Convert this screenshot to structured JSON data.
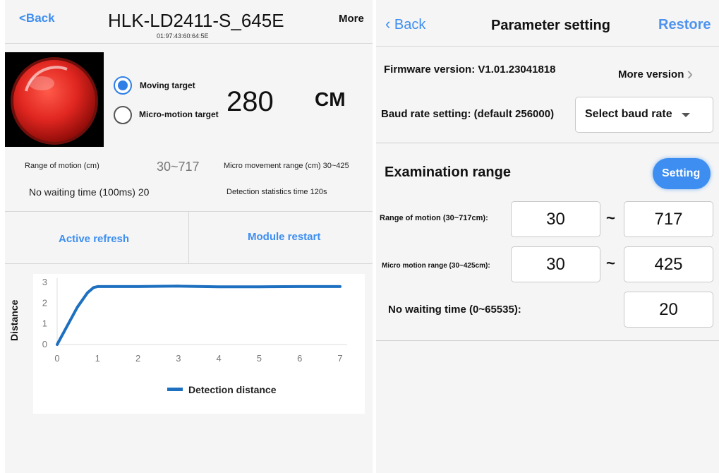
{
  "left": {
    "header": {
      "back_label": "<Back",
      "title": "HLK-LD2411-S_645E",
      "mac": "01:97:43:60:64:5E",
      "more_label": "More"
    },
    "status": {
      "moving_label": "Moving target",
      "micro_label": "Micro-motion target",
      "selected": "moving",
      "distance_value": "280",
      "distance_unit": "CM"
    },
    "info": {
      "range_motion_label": "Range of motion (cm)",
      "range_motion_value": "30~717",
      "micro_range_text": "Micro movement range (cm) 30~425",
      "no_wait_text": "No waiting time (100ms) 20",
      "detection_stats_text": "Detection statistics time 120s"
    },
    "actions": {
      "active_refresh": "Active refresh",
      "module_restart": "Module restart"
    },
    "accent_color": "#3d8ef0",
    "indicator_color": "#e02620"
  },
  "chart_data": {
    "type": "line",
    "ylabel": "Distance",
    "xlabel": "",
    "x_ticks": [
      "0",
      "1",
      "2",
      "3",
      "4",
      "5",
      "6",
      "7"
    ],
    "y_ticks": [
      "0",
      "1",
      "2",
      "3"
    ],
    "xlim": [
      0,
      7
    ],
    "ylim": [
      0,
      3
    ],
    "legend_position": "bottom",
    "series": [
      {
        "name": "Detection distance",
        "color": "#1d6fbf",
        "x": [
          0,
          0.25,
          0.5,
          0.75,
          0.9,
          1,
          2,
          3,
          4,
          5,
          6,
          7
        ],
        "values": [
          0,
          0.9,
          1.8,
          2.5,
          2.75,
          2.8,
          2.8,
          2.82,
          2.79,
          2.79,
          2.8,
          2.8
        ]
      }
    ]
  },
  "right": {
    "header": {
      "back_label": "Back",
      "title": "Parameter setting",
      "restore_label": "Restore"
    },
    "firmware": {
      "label": "Firmware version: V1.01.23041818",
      "more_version": "More version"
    },
    "baud": {
      "label": "Baud rate setting: (default 256000)",
      "select_label": "Select baud rate"
    },
    "exam": {
      "title": "Examination range",
      "setting_button": "Setting",
      "motion_label": "Range of motion (30~717cm):",
      "motion_min": "30",
      "motion_max": "717",
      "micro_label": "Micro motion range (30~425cm):",
      "micro_min": "30",
      "micro_max": "425",
      "tilde": "~",
      "nowait_label": "No waiting time (0~65535):",
      "nowait_value": "20"
    }
  }
}
